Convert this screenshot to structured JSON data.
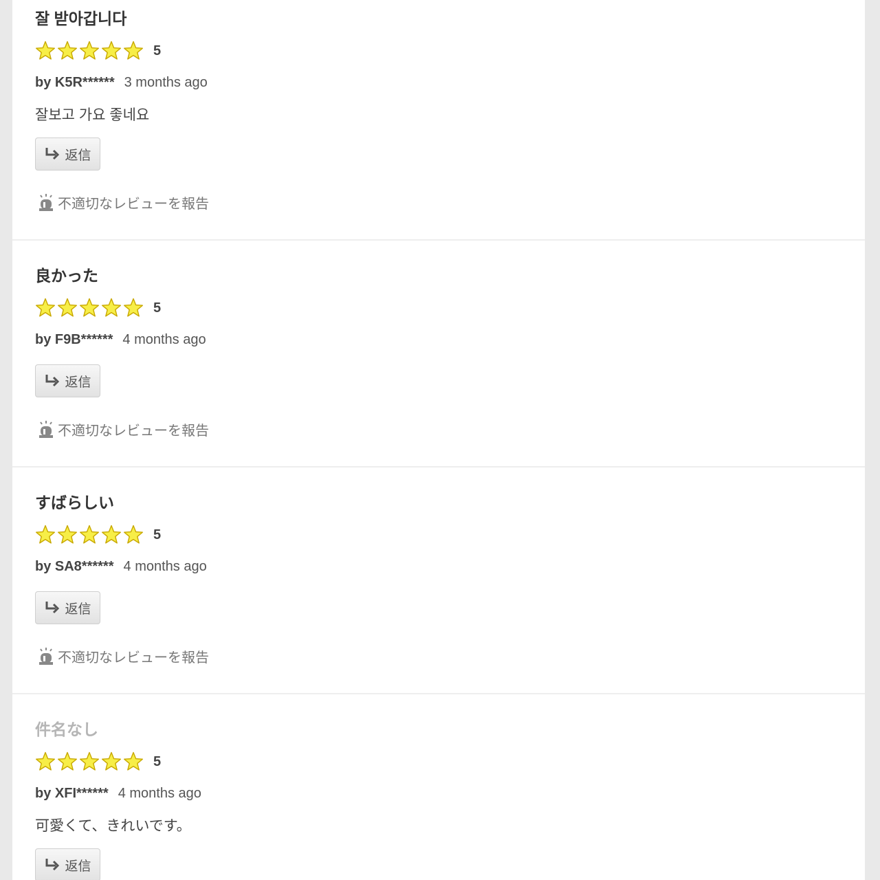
{
  "reviews": [
    {
      "title": "잘 받아갑니다",
      "rating": 5,
      "rating_label": "5",
      "author": "by K5R******",
      "date": "3 months ago",
      "body": "잘보고 가요 좋네요",
      "reply_label": "返信",
      "report_label": "不適切なレビューを報告"
    },
    {
      "title": "良かった",
      "rating": 5,
      "rating_label": "5",
      "author": "by F9B******",
      "date": "4 months ago",
      "body": "",
      "reply_label": "返信",
      "report_label": "不適切なレビューを報告"
    },
    {
      "title": "すばらしい",
      "rating": 5,
      "rating_label": "5",
      "author": "by SA8******",
      "date": "4 months ago",
      "body": "",
      "reply_label": "返信",
      "report_label": "不適切なレビューを報告"
    },
    {
      "title": "件名なし",
      "rating": 5,
      "rating_label": "5",
      "author": "by XFI******",
      "date": "4 months ago",
      "body": "可愛くて、きれいです。",
      "reply_label": "返信",
      "report_label": ""
    }
  ],
  "colors": {
    "star_fill": "#f7ee47",
    "star_stroke": "#c8a800",
    "muted_title": "#b5b5b5"
  },
  "icons": {
    "star": "star-icon",
    "reply": "reply-arrow-icon",
    "report": "siren-icon"
  }
}
